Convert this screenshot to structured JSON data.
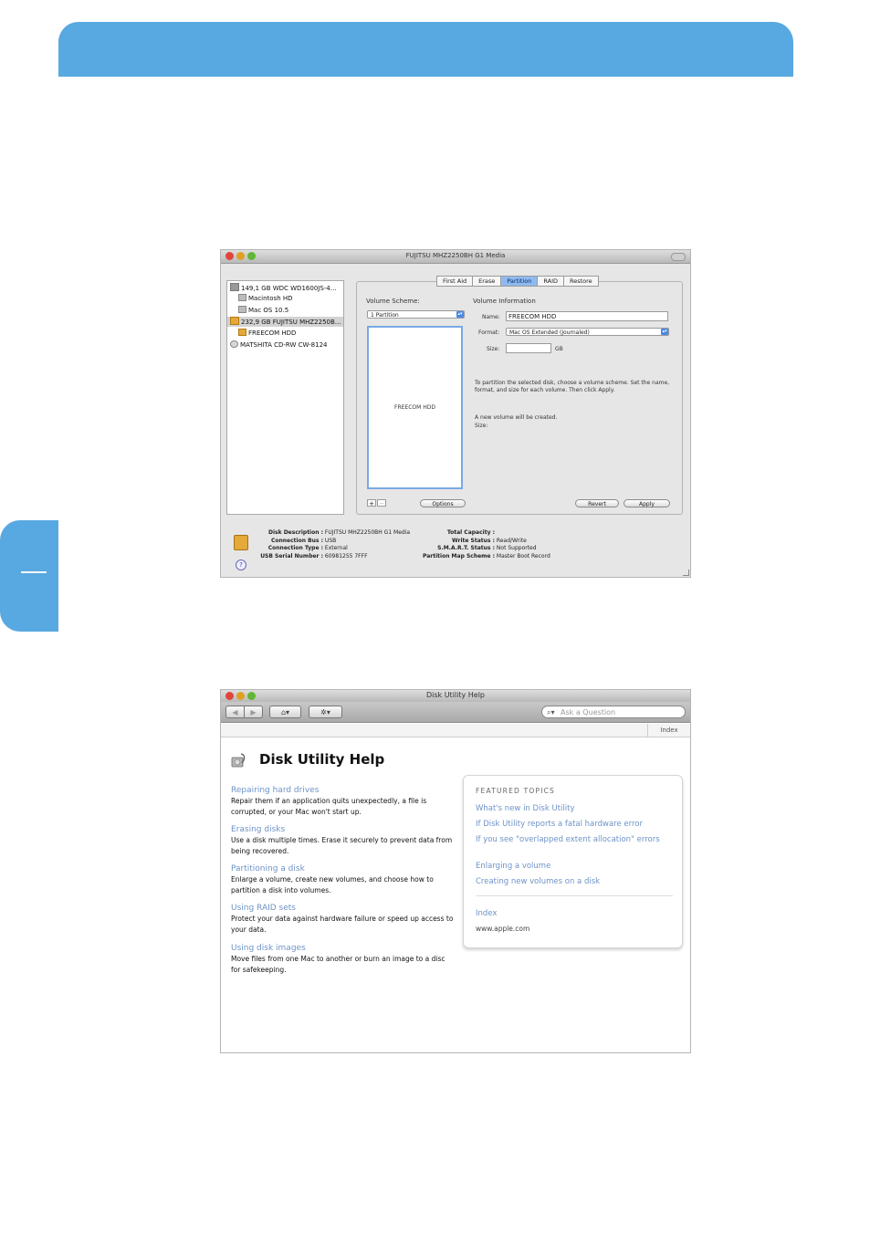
{
  "disk_utility": {
    "title": "FUJITSU MHZ2250BH G1 Media",
    "sources": [
      "149,1 GB WDC WD1600JS-4…",
      "Macintosh HD",
      "Mac OS 10.5",
      "232,9 GB FUJITSU MHZ2250B…",
      "FREECOM HDD",
      "MATSHITA CD-RW CW-8124"
    ],
    "tabs": [
      "First Aid",
      "Erase",
      "Partition",
      "RAID",
      "Restore"
    ],
    "volume_scheme_label": "Volume Scheme:",
    "volume_scheme_value": "1 Partition",
    "volume_info_label": "Volume Information",
    "name_label": "Name:",
    "name_value": "FREECOM HDD",
    "format_label": "Format:",
    "format_value": "Mac OS Extended (Journaled)",
    "size_label": "Size:",
    "size_unit": "GB",
    "volume_box_label": "FREECOM HDD",
    "instructions": "To partition the selected disk, choose a volume scheme. Set the name, format, and size for each volume. Then click Apply.",
    "new_volume_note": "A new volume will be created.",
    "new_volume_size": "Size:",
    "plus": "+",
    "minus": "−",
    "options_btn": "Options",
    "revert_btn": "Revert",
    "apply_btn": "Apply",
    "info_left": [
      {
        "k": "Disk Description :",
        "v": "FUJITSU MHZ2250BH G1 Media"
      },
      {
        "k": "Connection Bus :",
        "v": "USB"
      },
      {
        "k": "Connection Type :",
        "v": "External"
      },
      {
        "k": "USB Serial Number :",
        "v": "60981255 7FFF"
      }
    ],
    "info_right": [
      {
        "k": "Total Capacity :",
        "v": ""
      },
      {
        "k": "Write Status :",
        "v": "Read/Write"
      },
      {
        "k": "S.M.A.R.T. Status :",
        "v": "Not Supported"
      },
      {
        "k": "Partition Map Scheme :",
        "v": "Master Boot Record"
      }
    ],
    "help_glyph": "?"
  },
  "help_window": {
    "title": "Disk Utility Help",
    "back": "◀",
    "forward": "▶",
    "home": "⌂▾",
    "gear": "✲▾",
    "search_placeholder": "Ask a Question",
    "index_tab": "Index",
    "heading": "Disk Utility Help",
    "topics": [
      {
        "title": "Repairing hard drives",
        "desc": "Repair them if an application quits unexpectedly, a file is corrupted, or your Mac won't start up."
      },
      {
        "title": "Erasing disks",
        "desc": "Use a disk multiple times. Erase it securely to prevent data from being recovered."
      },
      {
        "title": "Partitioning a disk",
        "desc": "Enlarge a volume, create new volumes, and choose how to partition a disk into volumes."
      },
      {
        "title": "Using RAID sets",
        "desc": "Protect your data against hardware failure or speed up access to your data."
      },
      {
        "title": "Using disk images",
        "desc": "Move files from one Mac to another or burn an image to a disc for safekeeping."
      }
    ],
    "featured_heading": "FEATURED TOPICS",
    "featured": [
      "What's new in Disk Utility",
      "If Disk Utility reports a fatal hardware error",
      "If you see \"overlapped extent allocation\" errors",
      "Enlarging a volume",
      "Creating new volumes on a disk"
    ],
    "index_link": "Index",
    "website": "www.apple.com"
  },
  "colors": {
    "brand": "#58a8e1",
    "link": "#6e93c7"
  }
}
